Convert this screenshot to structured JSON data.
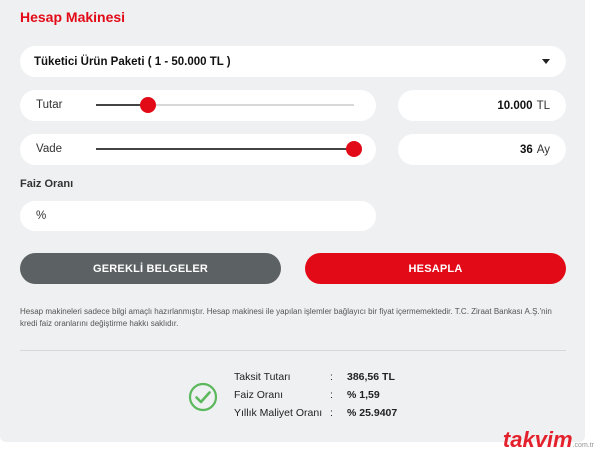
{
  "header": {
    "title": "Hesap Makinesi"
  },
  "package_select": {
    "selected": "Tüketici Ürün Paketi ( 1 - 50.000 TL )"
  },
  "amount": {
    "label": "Tutar",
    "value": "10.000",
    "unit": "TL",
    "slider_fraction": 0.2
  },
  "term": {
    "label": "Vade",
    "value": "36",
    "unit": "Ay",
    "slider_fraction": 1.0
  },
  "interest": {
    "label": "Faiz Oranı",
    "placeholder": "%"
  },
  "buttons": {
    "documents": "GEREKLİ BELGELER",
    "calculate": "HESAPLA"
  },
  "disclaimer": "Hesap makineleri sadece bilgi amaçlı hazırlanmıştır. Hesap makinesi ile yapılan işlemler bağlayıcı bir fiyat içermemektedir. T.C. Ziraat Bankası A.Ş.'nin kredi faiz oranlarını değiştirme hakkı saklıdır.",
  "results": [
    {
      "label": "Taksit Tutarı",
      "sep": ":",
      "value": "386,56 TL"
    },
    {
      "label": "Faiz Oranı",
      "sep": ":",
      "value": "% 1,59"
    },
    {
      "label": "Yıllık Maliyet Oranı",
      "sep": ":",
      "value": "% 25.9407"
    }
  ],
  "watermark": {
    "brand": "takvim",
    "suffix": ".com.tr"
  },
  "colors": {
    "accent": "#e30a17",
    "dark_button": "#5c6164",
    "success": "#5cb85c"
  },
  "icons": {
    "success": "check-circle-icon",
    "dropdown": "chevron-down-icon"
  }
}
